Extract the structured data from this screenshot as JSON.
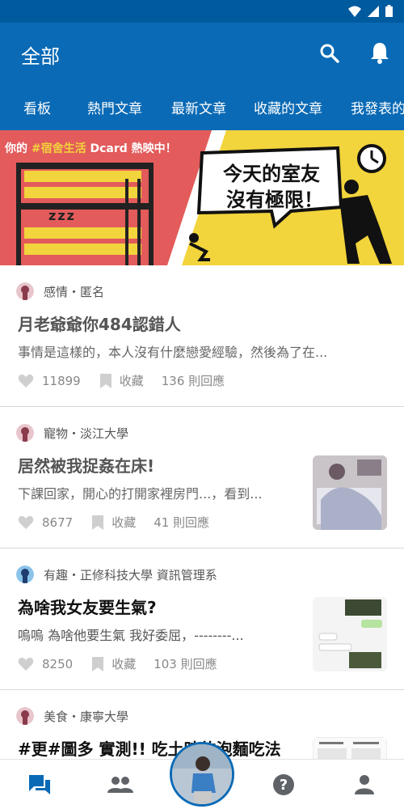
{
  "header": {
    "title": "全部",
    "search_icon": "search-icon",
    "notification_icon": "bell-icon"
  },
  "tabs": [
    {
      "label": "看板"
    },
    {
      "label": "熱門文章"
    },
    {
      "label": "最新文章"
    },
    {
      "label": "收藏的文章"
    },
    {
      "label": "我發表的"
    }
  ],
  "banner": {
    "tagline_prefix": "你的",
    "tagline_highlight": "#宿舍生活",
    "tagline_suffix": "Dcard 熱映中！",
    "bubble_line1": "今天的室友",
    "bubble_line2": "沒有極限！",
    "zzz": "zzz",
    "colors": {
      "left": "#e35b5b",
      "right": "#f2d43c"
    }
  },
  "posts": [
    {
      "board": "感情・匿名",
      "title": "月老爺爺你484認錯人",
      "excerpt": "事情是這樣的，本人沒有什麼戀愛經驗，然後為了在...",
      "likes": "11899",
      "save_label": "收藏",
      "replies": "136 則回應",
      "read": true
    },
    {
      "board": "寵物・淡江大學",
      "title": "居然被我捉姦在床!",
      "excerpt": "下課回家，開心的打開家裡房門...，看到...",
      "likes": "8677",
      "save_label": "收藏",
      "replies": "41 則回應",
      "read": true
    },
    {
      "board": "有趣・正修科技大學 資訊管理系",
      "title": "為啥我女友要生氣?",
      "excerpt": "嗚嗚 為啥他要生氣 我好委屈，--------...",
      "likes": "8250",
      "save_label": "收藏",
      "replies": "103 則回應",
      "read": false
    },
    {
      "board": "美食・康寧大學",
      "title": "#更#圖多 實測!! 吃土時的泡麵吃法",
      "read": false
    }
  ],
  "bottom_nav": [
    {
      "icon": "forum-icon"
    },
    {
      "icon": "people-icon"
    },
    {
      "icon": "profile-photo"
    },
    {
      "icon": "help-icon"
    },
    {
      "icon": "person-icon"
    }
  ],
  "colors": {
    "primary": "#0a6ab5",
    "status_bar": "#005a9e",
    "meta_text": "#555555"
  }
}
